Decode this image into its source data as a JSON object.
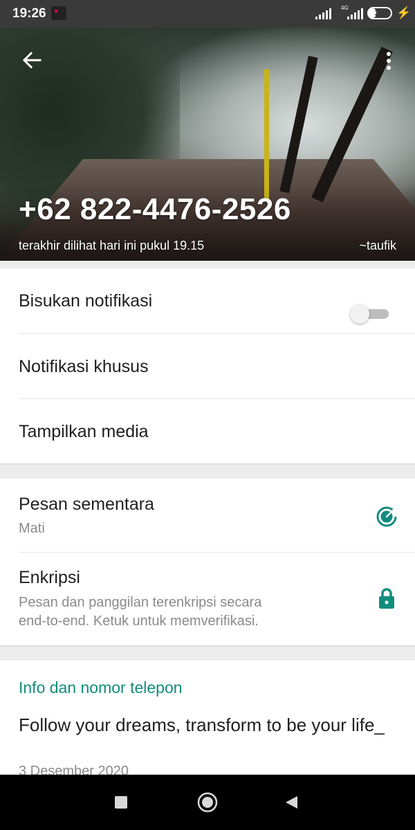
{
  "status_bar": {
    "time": "19:26",
    "network": "4G",
    "battery": "35",
    "battery_level": 0.35,
    "icons": [
      "signal-icon",
      "signal-icon",
      "battery-icon",
      "charging-icon"
    ]
  },
  "contact": {
    "phone": "+62 822-4476-2526",
    "last_seen": "terakhir dilihat hari ini pukul 19.15",
    "push_name": "~taufik"
  },
  "settings": {
    "mute_label": "Bisukan notifikasi",
    "mute_enabled": false,
    "custom_notif_label": "Notifikasi khusus",
    "media_label": "Tampilkan media",
    "disappearing_label": "Pesan sementara",
    "disappearing_value": "Mati",
    "encryption_label": "Enkripsi",
    "encryption_desc_line1": "Pesan dan panggilan terenkripsi secara",
    "encryption_desc_line2": "end-to-end. Ketuk untuk memverifikasi."
  },
  "about": {
    "section_title": "Info dan nomor telepon",
    "text": "Follow your dreams, transform to be your life_",
    "date": "3 Desember 2020"
  },
  "colors": {
    "accent": "#128c7e",
    "status_bar": "#3a3a3a"
  }
}
